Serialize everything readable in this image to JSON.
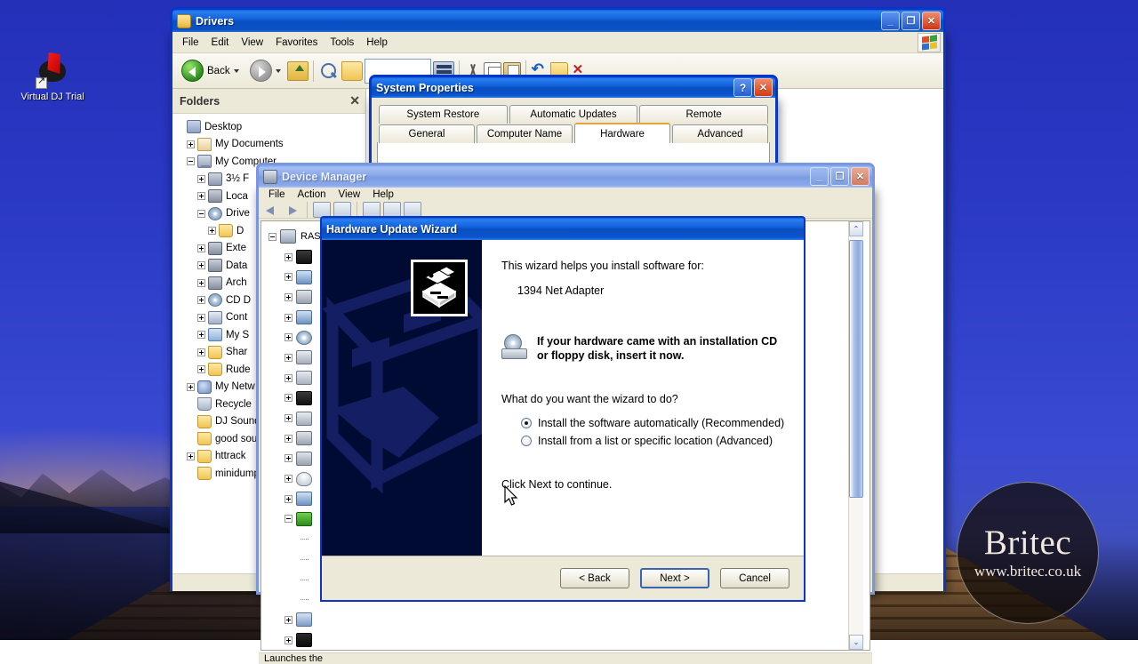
{
  "desktop": {
    "icons": [
      {
        "label": "Virtual DJ Trial",
        "icon": "virtualdj-icon"
      }
    ],
    "wallpaper_colors": {
      "sky": "#2a38c4",
      "pyramid": "#8c5f33"
    }
  },
  "watermark": {
    "brand": "Britec",
    "url": "www.britec.co.uk"
  },
  "explorer": {
    "title": "Drivers",
    "icon": "folder-icon",
    "window_buttons": {
      "minimize": "_",
      "maximize": "❐",
      "close": "✕"
    },
    "menu": [
      "File",
      "Edit",
      "View",
      "Favorites",
      "Tools",
      "Help"
    ],
    "toolbar": {
      "back_label": "Back",
      "items": [
        "back-button",
        "forward-button",
        "up-button",
        "search-button",
        "folders-button",
        "views-button",
        "cut-button",
        "copy-button",
        "paste-button",
        "undo-button",
        "new-folder-button",
        "delete-button"
      ]
    },
    "folders_pane": {
      "title": "Folders",
      "close_label": "✕",
      "tree": [
        {
          "label": "Desktop",
          "indent": 0,
          "expander": "none",
          "icon": "desktop-icon"
        },
        {
          "label": "My Documents",
          "indent": 1,
          "expander": "plus",
          "icon": "my-documents-icon"
        },
        {
          "label": "My Computer",
          "indent": 1,
          "expander": "minus",
          "icon": "my-computer-icon"
        },
        {
          "label": "3½ F",
          "indent": 2,
          "expander": "plus",
          "icon": "floppy-drive-icon"
        },
        {
          "label": "Loca",
          "indent": 2,
          "expander": "plus",
          "icon": "hard-disk-icon"
        },
        {
          "label": "Drive",
          "indent": 2,
          "expander": "minus",
          "icon": "disk-icon"
        },
        {
          "label": "D",
          "indent": 3,
          "expander": "plus",
          "icon": "folder-icon"
        },
        {
          "label": "Exte",
          "indent": 2,
          "expander": "plus",
          "icon": "hard-disk-icon"
        },
        {
          "label": "Data",
          "indent": 2,
          "expander": "plus",
          "icon": "hard-disk-icon"
        },
        {
          "label": "Arch",
          "indent": 2,
          "expander": "plus",
          "icon": "hard-disk-icon"
        },
        {
          "label": "CD D",
          "indent": 2,
          "expander": "plus",
          "icon": "cd-drive-icon"
        },
        {
          "label": "Cont",
          "indent": 2,
          "expander": "plus",
          "icon": "control-panel-icon"
        },
        {
          "label": "My S",
          "indent": 2,
          "expander": "plus",
          "icon": "my-shared-folder-icon"
        },
        {
          "label": "Shar",
          "indent": 2,
          "expander": "plus",
          "icon": "shared-folder-icon"
        },
        {
          "label": "Rude",
          "indent": 2,
          "expander": "plus",
          "icon": "folder-icon"
        },
        {
          "label": "My Netw",
          "indent": 1,
          "expander": "plus",
          "icon": "network-icon"
        },
        {
          "label": "Recycle",
          "indent": 1,
          "expander": "none",
          "icon": "recycle-bin-icon"
        },
        {
          "label": "DJ Sound",
          "indent": 1,
          "expander": "none",
          "icon": "folder-icon"
        },
        {
          "label": "good sou",
          "indent": 1,
          "expander": "none",
          "icon": "folder-icon"
        },
        {
          "label": "httrack",
          "indent": 1,
          "expander": "plus",
          "icon": "folder-icon"
        },
        {
          "label": "minidump",
          "indent": 1,
          "expander": "none",
          "icon": "folder-icon"
        }
      ]
    }
  },
  "system_properties": {
    "title": "System Properties",
    "help_label": "?",
    "close_label": "✕",
    "tabs_row1": [
      {
        "label": "System Restore",
        "active": false
      },
      {
        "label": "Automatic Updates",
        "active": false
      },
      {
        "label": "Remote",
        "active": false
      }
    ],
    "tabs_row2": [
      {
        "label": "General",
        "active": false
      },
      {
        "label": "Computer Name",
        "active": false
      },
      {
        "label": "Hardware",
        "active": true
      },
      {
        "label": "Advanced",
        "active": false
      }
    ],
    "active_tab": "Hardware",
    "accent_color": "#e8a33d"
  },
  "device_manager": {
    "title": "Device Manager",
    "icon": "device-manager-icon",
    "active": false,
    "window_buttons": {
      "minimize": "_",
      "maximize": "❐",
      "close": "✕"
    },
    "menu": [
      "File",
      "Action",
      "View",
      "Help"
    ],
    "toolbar_items": [
      "back-button",
      "forward-button",
      "show-hide-tree-button",
      "properties-button",
      "scan-button",
      "update-driver-button",
      "uninstall-button"
    ],
    "root_label": "RAS",
    "tree_nodes": [
      {
        "expander": "minus",
        "icon": "computer-icon",
        "indent": 0
      },
      {
        "expander": "plus",
        "icon": "chip-icon",
        "indent": 1
      },
      {
        "expander": "plus",
        "icon": "monitor-icon",
        "indent": 1
      },
      {
        "expander": "plus",
        "icon": "disk-drive-icon",
        "indent": 1
      },
      {
        "expander": "plus",
        "icon": "monitor-icon",
        "indent": 1
      },
      {
        "expander": "plus",
        "icon": "cd-drive-icon",
        "indent": 1
      },
      {
        "expander": "plus",
        "icon": "printer-icon",
        "indent": 1
      },
      {
        "expander": "plus",
        "icon": "keyboard-icon",
        "indent": 1
      },
      {
        "expander": "plus",
        "icon": "ide-controller-icon",
        "indent": 1
      },
      {
        "expander": "plus",
        "icon": "printer-icon",
        "indent": 1
      },
      {
        "expander": "plus",
        "icon": "disk-drive-icon",
        "indent": 1
      },
      {
        "expander": "plus",
        "icon": "disk-drive-icon",
        "indent": 1
      },
      {
        "expander": "plus",
        "icon": "mouse-icon",
        "indent": 1
      },
      {
        "expander": "plus",
        "icon": "monitor-icon",
        "indent": 1
      },
      {
        "expander": "minus",
        "icon": "network-adapter-icon",
        "indent": 1
      },
      {
        "expander": "leaf",
        "icon": "none",
        "indent": 2
      },
      {
        "expander": "leaf",
        "icon": "none",
        "indent": 2
      },
      {
        "expander": "leaf",
        "icon": "none",
        "indent": 2
      },
      {
        "expander": "leaf",
        "icon": "none",
        "indent": 2
      },
      {
        "expander": "plus",
        "icon": "sound-icon",
        "indent": 1
      },
      {
        "expander": "plus",
        "icon": "usb-controller-icon",
        "indent": 1
      }
    ],
    "status_text": "Launches the",
    "scrollbar": {
      "up": "⌃",
      "down": "⌄"
    }
  },
  "wizard": {
    "title": "Hardware Update Wizard",
    "sidebar_icon": "hardware-wizard-icon",
    "intro_text": "This wizard helps you install software for:",
    "device_name": "1394 Net Adapter",
    "cd_icon": "installation-cd-icon",
    "cd_notice_line1": "If your hardware came with an installation CD",
    "cd_notice_line2": "or floppy disk, insert it now.",
    "question": "What do you want the wizard to do?",
    "options": [
      {
        "label": "Install the software automatically (Recommended)",
        "selected": true
      },
      {
        "label": "Install from a list or specific location (Advanced)",
        "selected": false
      }
    ],
    "footer_note": "Click Next to continue.",
    "buttons": [
      {
        "label": "< Back",
        "default": false
      },
      {
        "label": "Next >",
        "default": true
      },
      {
        "label": "Cancel",
        "default": false
      }
    ]
  }
}
